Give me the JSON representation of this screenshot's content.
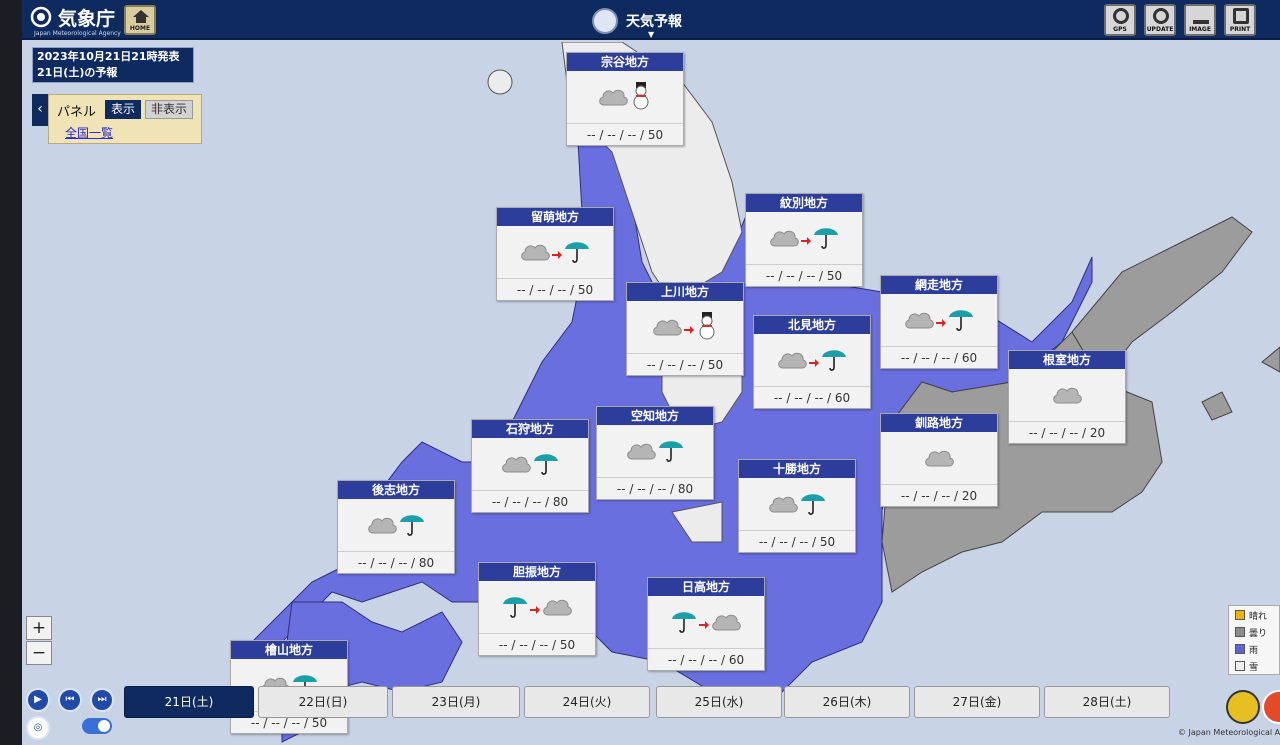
{
  "header": {
    "agency_name": "気象庁",
    "agency_sub": "Japan Meteorological Agency",
    "home_label": "HOME",
    "page_title": "天気予報",
    "tools": [
      {
        "label": "GPS",
        "icon": "gps-icon"
      },
      {
        "label": "UPDATE",
        "icon": "update-icon"
      },
      {
        "label": "IMAGE",
        "icon": "download-icon"
      },
      {
        "label": "PRINT",
        "icon": "print-icon"
      }
    ]
  },
  "issue": {
    "line1": "2023年10月21日21時発表",
    "line2": "21日(土)の予報"
  },
  "panel": {
    "label": "パネル",
    "show_label": "表示",
    "hide_label": "非表示",
    "list_link": "全国一覧"
  },
  "regions": [
    {
      "name": "宗谷地方",
      "pop": "-- / -- / -- / 50",
      "icons": [
        "cloud-icon",
        "snowman-icon"
      ]
    },
    {
      "name": "留萌地方",
      "pop": "-- / -- / -- / 50",
      "icons": [
        "cloud-icon",
        "arrow-icon",
        "umbrella-icon"
      ]
    },
    {
      "name": "紋別地方",
      "pop": "-- / -- / -- / 50",
      "icons": [
        "cloud-icon",
        "arrow-icon",
        "umbrella-icon"
      ]
    },
    {
      "name": "上川地方",
      "pop": "-- / -- / -- / 50",
      "icons": [
        "cloud-icon",
        "arrow-icon",
        "snowman-icon"
      ]
    },
    {
      "name": "網走地方",
      "pop": "-- / -- / -- / 60",
      "icons": [
        "cloud-icon",
        "arrow-icon",
        "umbrella-icon"
      ]
    },
    {
      "name": "北見地方",
      "pop": "-- / -- / -- / 60",
      "icons": [
        "cloud-icon",
        "arrow-icon",
        "umbrella-icon"
      ]
    },
    {
      "name": "根室地方",
      "pop": "-- / -- / -- / 20",
      "icons": [
        "cloud-icon"
      ]
    },
    {
      "name": "石狩地方",
      "pop": "-- / -- / -- / 80",
      "icons": [
        "cloud-icon",
        "umbrella-icon"
      ]
    },
    {
      "name": "空知地方",
      "pop": "-- / -- / -- / 80",
      "icons": [
        "cloud-icon",
        "umbrella-icon"
      ]
    },
    {
      "name": "釧路地方",
      "pop": "-- / -- / -- / 20",
      "icons": [
        "cloud-icon"
      ]
    },
    {
      "name": "十勝地方",
      "pop": "-- / -- / -- / 50",
      "icons": [
        "cloud-icon",
        "umbrella-icon"
      ]
    },
    {
      "name": "後志地方",
      "pop": "-- / -- / -- / 80",
      "icons": [
        "cloud-icon",
        "umbrella-icon"
      ]
    },
    {
      "name": "胆振地方",
      "pop": "-- / -- / -- / 50",
      "icons": [
        "umbrella-icon",
        "arrow-icon",
        "cloud-icon"
      ]
    },
    {
      "name": "日高地方",
      "pop": "-- / -- / -- / 60",
      "icons": [
        "umbrella-icon",
        "arrow-icon",
        "cloud-icon"
      ]
    },
    {
      "name": "檜山地方",
      "pop": "-- / -- / -- / 50",
      "icons": [
        "cloud-icon",
        "umbrella-icon"
      ]
    }
  ],
  "zoom": {
    "in": "+",
    "out": "−"
  },
  "dates": [
    "21日(土)",
    "22日(日)",
    "23日(月)",
    "24日(火)",
    "25日(水)",
    "26日(木)",
    "27日(金)",
    "28日(土)"
  ],
  "active_date": "21日(土)",
  "legend": [
    {
      "label": "晴れ",
      "color": "#f0b400"
    },
    {
      "label": "曇り",
      "color": "#8a8a8a"
    },
    {
      "label": "雨",
      "color": "#5e63d6"
    },
    {
      "label": "雪",
      "color": "#eeeeee"
    }
  ],
  "copyright": "© Japan Meteorological Agency",
  "colors": {
    "rain": "#6a6fe0",
    "cloud": "#9c9c9c",
    "snow": "#ececec",
    "sea": "#c9d3e6",
    "header": "#0f2a5e"
  }
}
